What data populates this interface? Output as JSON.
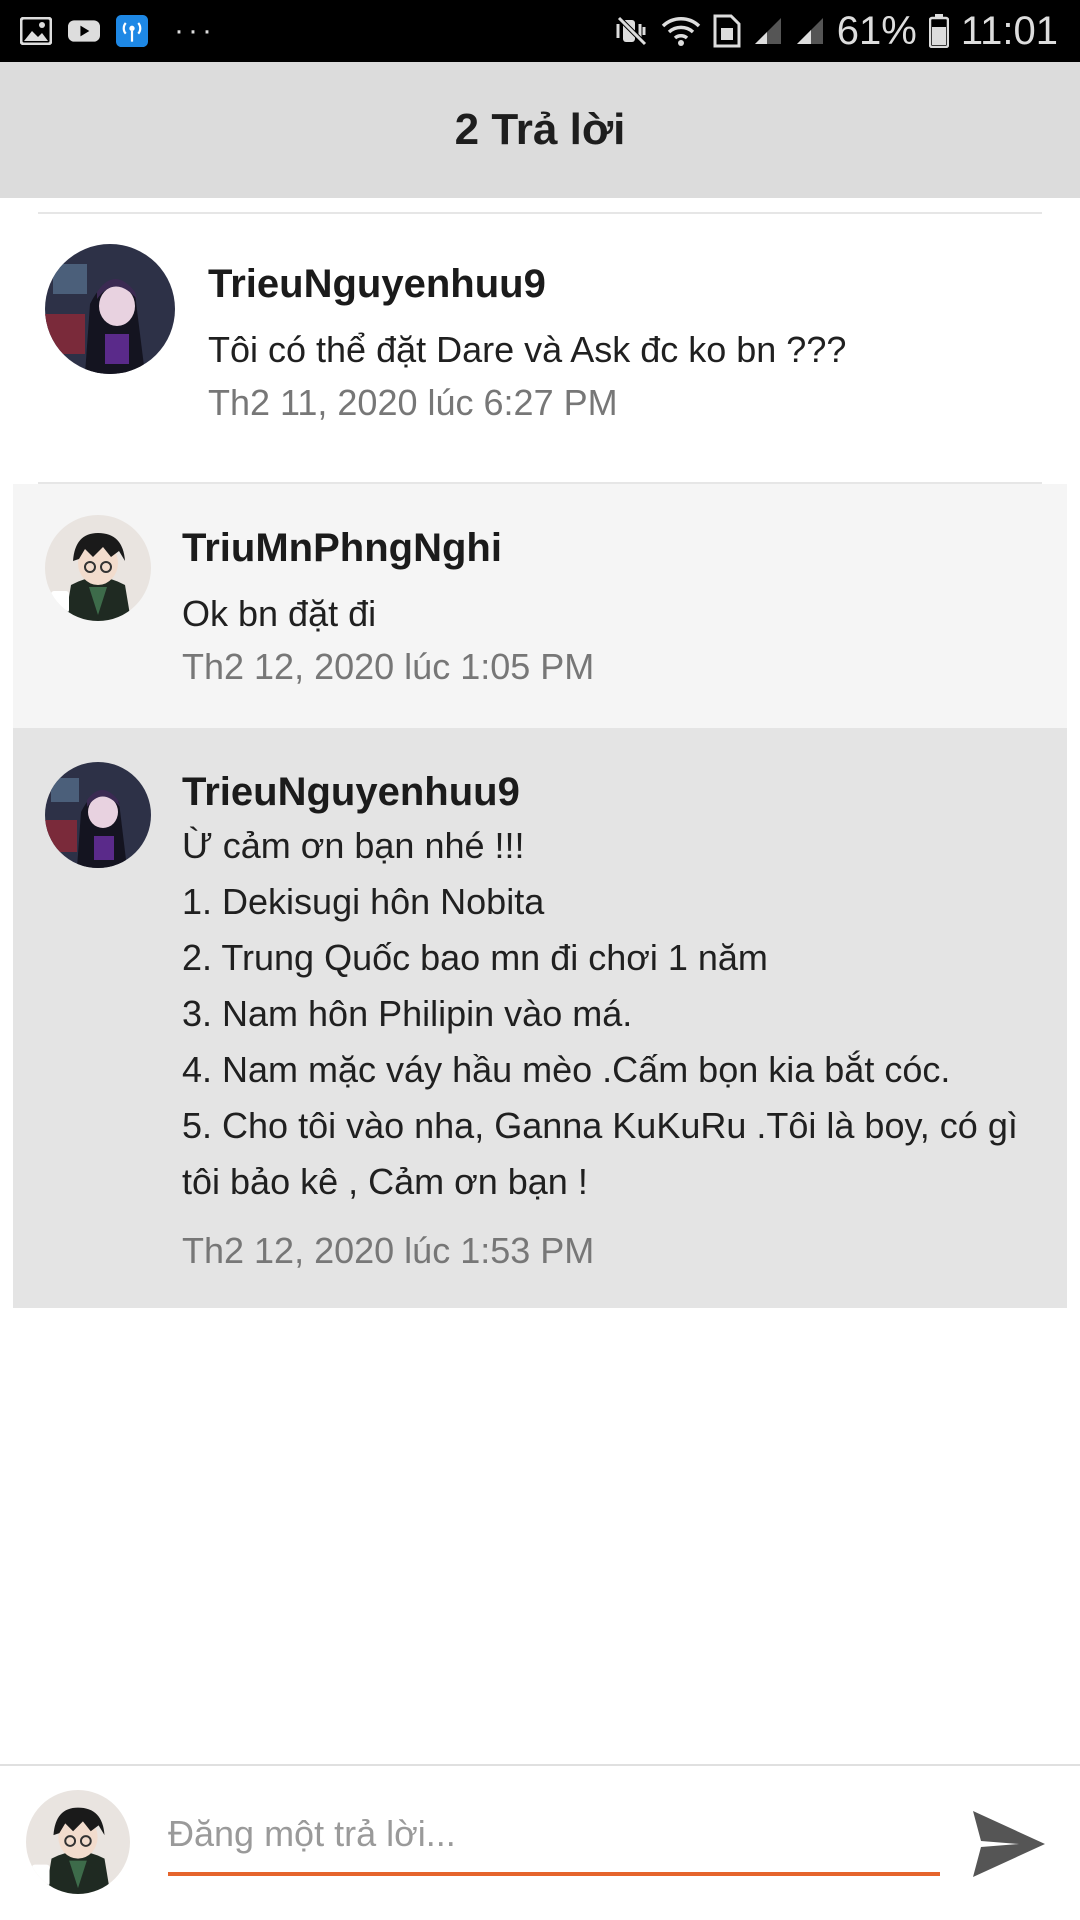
{
  "status_bar": {
    "battery_text": "61%",
    "time": "11:01",
    "icons": [
      "gallery-icon",
      "youtube-icon",
      "hotspot-icon",
      "more-dots-icon",
      "mute-icon",
      "wifi-icon",
      "sim-icon",
      "signal-icon",
      "signal-icon",
      "battery-icon"
    ],
    "dots": "···"
  },
  "header": {
    "title": "2 Trả lời"
  },
  "comments": [
    {
      "author": "TrieuNguyenhuu9",
      "lines": [
        "Tôi có thể đặt Dare và Ask đc ko bn ???"
      ],
      "time": "Th2 11, 2020 lúc 6:27 PM"
    },
    {
      "author": "TriuMnPhngNghi",
      "lines": [
        "Ok bn đặt đi"
      ],
      "time": "Th2 12, 2020 lúc 1:05 PM"
    },
    {
      "author": "TrieuNguyenhuu9",
      "lines": [
        "Ừ cảm ơn bạn nhé !!!",
        "1. Dekisugi hôn Nobita",
        "2. Trung Quốc bao mn đi chơi 1 năm",
        "3. Nam hôn Philipin vào má.",
        "4. Nam mặc váy hầu mèo .Cấm bọn kia bắt cóc.",
        "5. Cho tôi vào nha, Ganna KuKuRu .Tôi là boy, có gì",
        "tôi bảo kê , Cảm ơn  bạn !"
      ],
      "time": "Th2 12, 2020 lúc 1:53 PM"
    }
  ],
  "reply": {
    "placeholder": "Đăng một trả lời...",
    "value": ""
  },
  "colors": {
    "header_bg": "#dcdcdc",
    "accent": "#e5642c",
    "reply_alt_bg": "#f5f5f5",
    "highlight_bg": "#e4e4e4"
  }
}
